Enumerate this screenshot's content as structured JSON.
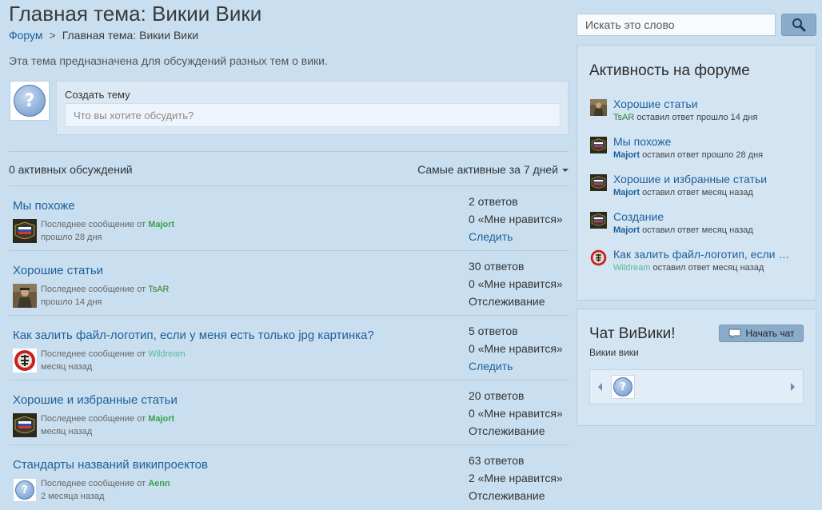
{
  "page": {
    "title": "Главная тема: Викии Вики",
    "breadcrumb": {
      "forum": "Форум",
      "separator": ">",
      "current": "Главная тема: Викии Вики"
    },
    "description": "Эта тема предназначена для обсуждений разных тем о вики."
  },
  "create": {
    "label": "Создать тему",
    "placeholder": "Что вы хотите обсудить?"
  },
  "list_header": {
    "count": "0 активных обсуждений",
    "sort": "Самые активные за 7 дней"
  },
  "threads": [
    {
      "title": "Мы похоже",
      "last_prefix": "Последнее сообщение от",
      "user": "Majort",
      "time": "прошло 28 дня",
      "replies": "2 ответов",
      "likes": "0 «Мне нравится»",
      "follow": "Следить",
      "avatar": "russia-flag-icon"
    },
    {
      "title": "Хорошие статьи",
      "last_prefix": "Последнее сообщение от",
      "user": "TsAR",
      "time": "прошло 14 дня",
      "replies": "30 ответов",
      "likes": "0 «Мне нравится»",
      "follow": "Отслеживание",
      "avatar": "soldier-photo-icon"
    },
    {
      "title": "Как залить файл-логотип, если у меня есть только jpg картинка?",
      "last_prefix": "Последнее сообщение от",
      "user": "Wildream",
      "time": "месяц назад",
      "replies": "5 ответов",
      "likes": "0 «Мне нравится»",
      "follow": "Следить",
      "avatar": "red-emblem-icon"
    },
    {
      "title": "Хорошие и избранные статьи",
      "last_prefix": "Последнее сообщение от",
      "user": "Majort",
      "time": "месяц назад",
      "replies": "20 ответов",
      "likes": "0 «Мне нравится»",
      "follow": "Отслеживание",
      "avatar": "russia-flag-icon"
    },
    {
      "title": "Стандарты названий википроектов",
      "last_prefix": "Последнее сообщение от",
      "user": "Aenn",
      "time": "2 месяца назад",
      "replies": "63 ответов",
      "likes": "2 «Мне нравится»",
      "follow": "Отслеживание",
      "avatar": "question-icon"
    }
  ],
  "search": {
    "placeholder": "Искать это слово"
  },
  "activity": {
    "title": "Активность на форуме",
    "items": [
      {
        "title": "Хорошие статьи",
        "user": "TsAR",
        "text": "оставил ответ прошло 14 дня",
        "avatar": "soldier-photo-icon"
      },
      {
        "title": "Мы похоже",
        "user": "Majort",
        "text": "оставил ответ прошло 28 дня",
        "avatar": "russia-flag-icon"
      },
      {
        "title": "Хорошие и избранные статьи",
        "user": "Majort",
        "text": "оставил ответ месяц назад",
        "avatar": "russia-flag-icon"
      },
      {
        "title": "Создание",
        "user": "Majort",
        "text": "оставил ответ месяц назад",
        "avatar": "russia-flag-icon"
      },
      {
        "title": "Как залить файл-логотип, если …",
        "user": "Wildream",
        "text": "оставил ответ месяц назад",
        "avatar": "red-emblem-icon"
      }
    ]
  },
  "chat": {
    "title": "Чат ВиВики!",
    "button": "Начать чат",
    "subtitle": "Викии вики"
  },
  "colors": {
    "background": "#c9dff0",
    "link": "#1f5f99",
    "panel": "#d3e5f3",
    "button": "#8aaccb"
  }
}
